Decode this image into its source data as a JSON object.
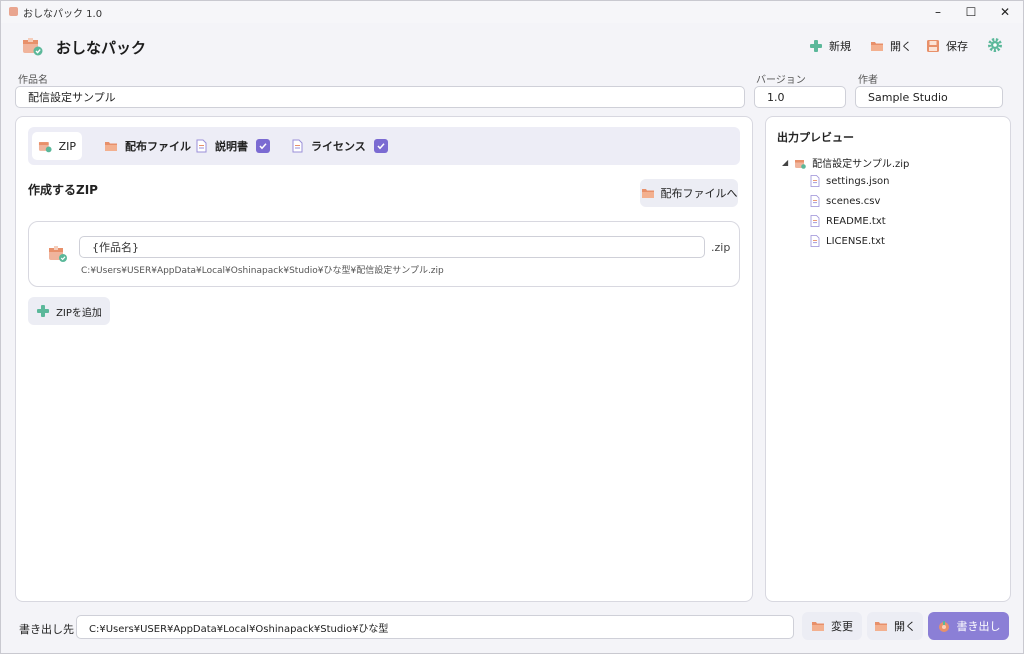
{
  "window": {
    "title": "おしなパック 1.0"
  },
  "header": {
    "app_name": "おしなパック",
    "new_label": "新規",
    "open_label": "開く",
    "save_label": "保存"
  },
  "form": {
    "work_name_label": "作品名",
    "work_name_value": "配信設定サンプル",
    "version_label": "バージョン",
    "version_value": "1.0",
    "author_label": "作者",
    "author_value": "Sample Studio"
  },
  "tabs": [
    {
      "label": "ZIP",
      "checked": false
    },
    {
      "label": "配布ファイル",
      "checked": false
    },
    {
      "label": "説明書",
      "checked": true
    },
    {
      "label": "ライセンス",
      "checked": true
    }
  ],
  "zip_section": {
    "title": "作成するZIP",
    "to_dist_label": "配布ファイルへ",
    "zip_name_value": "{作品名}",
    "zip_ext": ".zip",
    "zip_path": "C:¥Users¥USER¥AppData¥Local¥Oshinapack¥Studio¥ひな型¥配信設定サンプル.zip",
    "add_zip_label": "ZIPを追加"
  },
  "preview": {
    "title": "出力プレビュー",
    "root": "配信設定サンプル.zip",
    "files": [
      "settings.json",
      "scenes.csv",
      "README.txt",
      "LICENSE.txt"
    ]
  },
  "footer": {
    "output_label": "書き出し先",
    "output_path": "C:¥Users¥USER¥AppData¥Local¥Oshinapack¥Studio¥ひな型",
    "change_label": "変更",
    "open_label": "開く",
    "export_label": "書き出し"
  },
  "colors": {
    "accent": "#8b7fd6",
    "check": "#7b6bd2",
    "folder": "#e8906a",
    "plus": "#5bb89a"
  }
}
